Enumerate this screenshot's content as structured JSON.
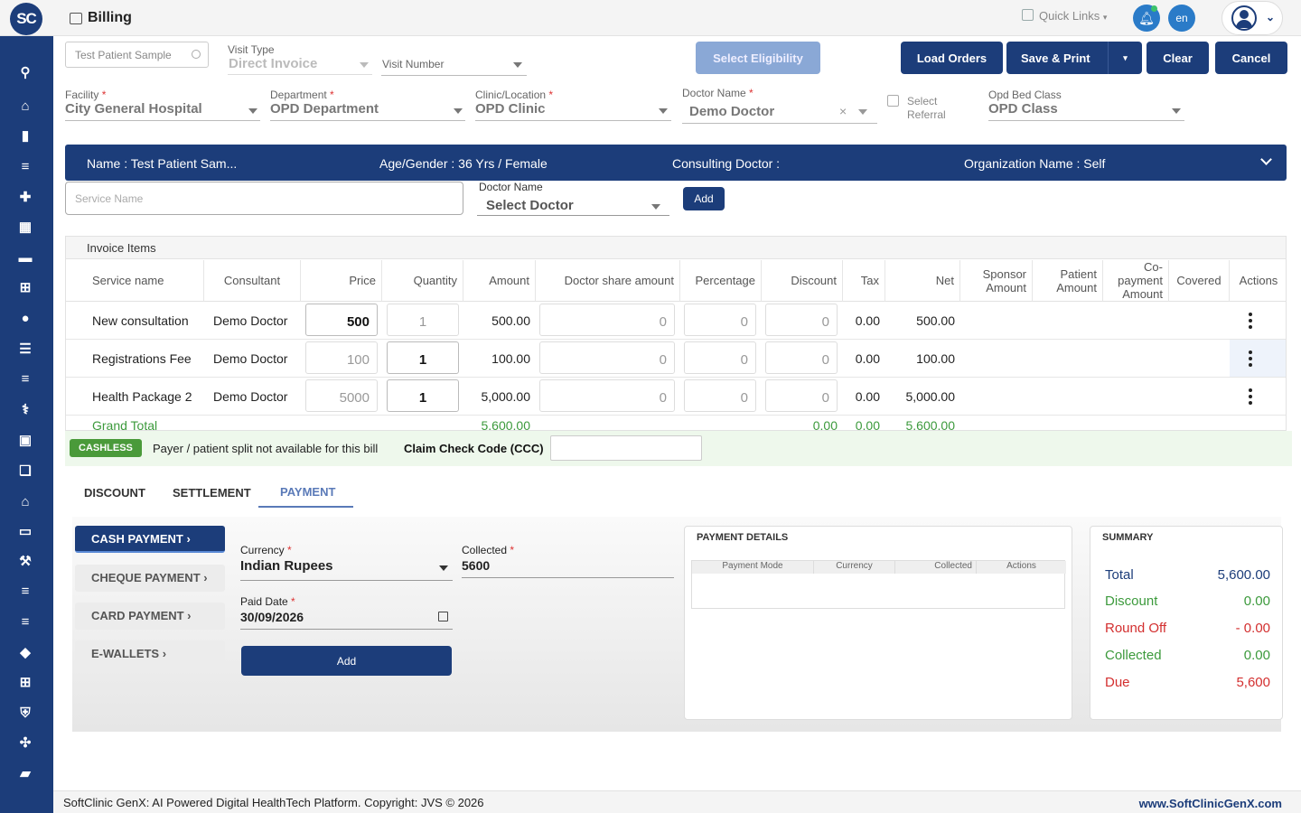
{
  "app": {
    "logo_text": "SC",
    "page_title": "Billing",
    "quick_links": "Quick Links",
    "lang": "en"
  },
  "sidebar": {
    "icons": [
      "search-icon",
      "home-icon",
      "chart-icon",
      "menu-icon",
      "medical-bag-icon",
      "calendar-icon",
      "bed-icon",
      "plus-square-icon",
      "person-icon",
      "list-icon",
      "menu-icon",
      "pill-icon",
      "medicine-box-icon",
      "book-icon",
      "building-icon",
      "devices-icon",
      "wrench-icon",
      "menu-icon",
      "menu-icon",
      "drop-icon",
      "add-box-icon",
      "shield-icon",
      "network-icon",
      "folder-icon"
    ]
  },
  "form": {
    "patient_search": "Test Patient Sample",
    "visit_type_label": "Visit Type",
    "visit_type_value": "Direct Invoice",
    "visit_number_label": "Visit Number",
    "select_eligibility": "Select Eligibility",
    "load_orders": "Load Orders",
    "save_print": "Save & Print",
    "clear": "Clear",
    "cancel": "Cancel",
    "facility_label": "Facility",
    "facility_value": "City General Hospital",
    "department_label": "Department",
    "department_value": "OPD Department",
    "clinic_label": "Clinic/Location",
    "clinic_value": "OPD Clinic",
    "doctor_label": "Doctor Name",
    "doctor_value": "Demo Doctor",
    "select_referral": "Select Referral",
    "bed_class_label": "Opd Bed Class",
    "bed_class_value": "OPD Class",
    "required_mark": "*"
  },
  "banner": {
    "name": "Name :  Test Patient Sam...",
    "age_gender": "Age/Gender :  36 Yrs / Female",
    "consulting": "Consulting Doctor :",
    "organization": "Organization Name :  Self"
  },
  "service": {
    "placeholder": "Service Name",
    "doctor_label": "Doctor Name",
    "doctor_value": "Select Doctor",
    "add": "Add"
  },
  "invoice": {
    "title": "Invoice Items",
    "headers": [
      "Service name",
      "Consultant",
      "Price",
      "Quantity",
      "Amount",
      "Doctor share amount",
      "Percentage",
      "Discount",
      "Tax",
      "Net",
      "Sponsor Amount",
      "Patient Amount",
      "Co-payment Amount",
      "Covered",
      "Actions"
    ],
    "rows": [
      {
        "service": "New consultation",
        "consultant": "Demo Doctor",
        "price": "500",
        "quantity": "1",
        "amount": "500.00",
        "share": "0",
        "percentage": "0",
        "discount": "0",
        "tax": "0.00",
        "net": "500.00"
      },
      {
        "service": "Registrations Fee",
        "consultant": "Demo Doctor",
        "price": "100",
        "quantity": "1",
        "amount": "100.00",
        "share": "0",
        "percentage": "0",
        "discount": "0",
        "tax": "0.00",
        "net": "100.00"
      },
      {
        "service": "Health Package 2",
        "consultant": "Demo Doctor",
        "price": "5000",
        "quantity": "1",
        "amount": "5,000.00",
        "share": "0",
        "percentage": "0",
        "discount": "0",
        "tax": "0.00",
        "net": "5,000.00"
      }
    ],
    "grand_total": {
      "label": "Grand Total",
      "amount": "5,600.00",
      "discount": "0.00",
      "tax": "0.00",
      "net": "5,600.00"
    }
  },
  "cashless": {
    "badge": "CASHLESS",
    "message": "Payer / patient split not available for this bill",
    "ccc_label": "Claim Check Code (CCC)"
  },
  "tabs": [
    "DISCOUNT",
    "SETTLEMENT",
    "PAYMENT"
  ],
  "payment": {
    "methods": [
      "CASH PAYMENT ›",
      "CHEQUE PAYMENT ›",
      "CARD PAYMENT ›",
      "E-WALLETS ›"
    ],
    "currency_label": "Currency",
    "currency_value": "Indian Rupees",
    "collected_label": "Collected",
    "collected_value": "5600",
    "paid_date_label": "Paid Date",
    "paid_date_value": "30/09/2026",
    "add": "Add"
  },
  "payment_details": {
    "title": "PAYMENT DETAILS",
    "headers": [
      "Payment Mode",
      "Currency",
      "Collected",
      "Actions"
    ]
  },
  "summary": {
    "title": "SUMMARY",
    "rows": [
      {
        "label": "Total",
        "value": "5,600.00",
        "color": "#1c3d7a"
      },
      {
        "label": "Discount",
        "value": "0.00",
        "color": "#3c9a3c"
      },
      {
        "label": "Round Off",
        "value": "- 0.00",
        "color": "#d32f2f"
      },
      {
        "label": "Collected",
        "value": "0.00",
        "color": "#3c9a3c"
      },
      {
        "label": "Due",
        "value": "5,600",
        "color": "#d32f2f"
      }
    ]
  },
  "footer": {
    "left": "SoftClinic GenX: AI Powered Digital HealthTech Platform. Copyright: JVS © 2026",
    "right": "www.SoftClinicGenX.com"
  },
  "colors": {
    "brand": "#1c3d7a",
    "accent": "#2a7bc8",
    "success": "#3c9a3c",
    "danger": "#d32f2f"
  }
}
